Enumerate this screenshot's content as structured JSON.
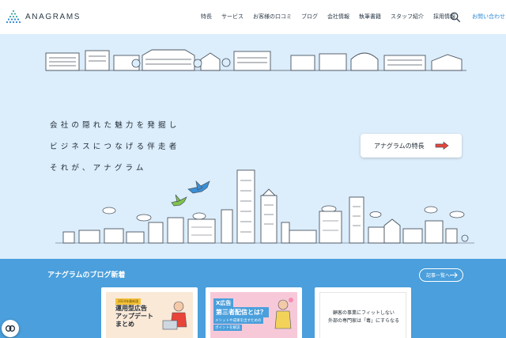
{
  "header": {
    "logo_text": "ANAGRAMS",
    "nav": [
      "特長",
      "サービス",
      "お客様の口コミ",
      "ブログ",
      "会社情報",
      "執筆書籍",
      "スタッフ紹介",
      "採用情報"
    ],
    "contact_label": "お問い合わせ"
  },
  "hero": {
    "tagline": [
      "会社の隠れた魅力を発掘し",
      "ビジネスにつなげる伴走者",
      "それが、アナグラム"
    ],
    "feature_button": "アナグラムの特長"
  },
  "blog": {
    "title": "アナグラムのブログ新着",
    "all_posts": "記事一覧へ",
    "cards": [
      {
        "badge": "2024年最新版",
        "title_lines": [
          "運用型広告",
          "アップデート",
          "まとめ"
        ]
      },
      {
        "badge": "X広告",
        "title": "第三者配信とは？",
        "sub_lines": [
          "メリットや成果を出すための",
          "ポイントを解説"
        ]
      },
      {
        "lines": [
          "顧客の事業にフィットしない",
          "外部の専門家は「毒」にすらなる"
        ]
      }
    ]
  },
  "colors": {
    "hero_bg": "#dcedfb",
    "blog_bg": "#4a9fdc",
    "accent_blue": "#2c86d6",
    "arrow_red": "#e8443a"
  },
  "icons": {
    "logo": "triangle-dots-logo-icon",
    "search": "search-icon",
    "arrow": "red-arrow-icon",
    "float": "chain-link-icon"
  }
}
